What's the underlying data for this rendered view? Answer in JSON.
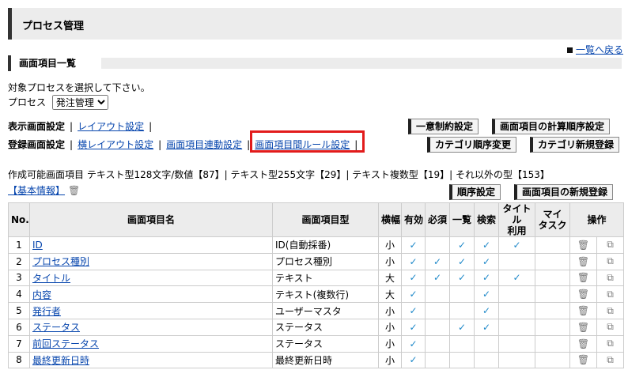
{
  "page_title": "プロセス管理",
  "back_link": "一覧へ戻る",
  "section_title": "画面項目一覧",
  "instruction": "対象プロセスを選択して下さい。",
  "process_label": "プロセス",
  "process_selected": "発注管理",
  "display_settings": {
    "label": "表示画面設定",
    "links": [
      "レイアウト設定"
    ]
  },
  "register_settings": {
    "label": "登録画面設定",
    "links": [
      "横レイアウト設定",
      "画面項目連動設定",
      "画面項目間ルール設定"
    ]
  },
  "buttons": {
    "unique_constraint": "一意制約設定",
    "calc_order": "画面項目の計算順序設定",
    "category_order": "カテゴリ順序変更",
    "category_new": "カテゴリ新規登録",
    "order_settings": "順序設定",
    "item_new": "画面項目の新規登録"
  },
  "type_summary": "作成可能画面項目 テキスト型128文字/数値【87】| テキスト型255文字【29】| テキスト複数型【19】| それ以外の型【153】",
  "basic_info": "【基本情報】",
  "table": {
    "headers": {
      "no": "No.",
      "name": "画面項目名",
      "type": "画面項目型",
      "width": "横幅",
      "valid": "有効",
      "required": "必須",
      "list": "一覧",
      "search": "検索",
      "title_use": "タイトル利用",
      "my_task": "マイタスク",
      "ops": "操作"
    },
    "rows": [
      {
        "no": "1",
        "name": "ID",
        "type": "ID(自動採番)",
        "width": "小",
        "valid": true,
        "required": false,
        "list": true,
        "search": true,
        "title_use": true
      },
      {
        "no": "2",
        "name": "プロセス種別",
        "type": "プロセス種別",
        "width": "小",
        "valid": true,
        "required": true,
        "list": true,
        "search": true,
        "title_use": false
      },
      {
        "no": "3",
        "name": "タイトル",
        "type": "テキスト",
        "width": "大",
        "valid": true,
        "required": true,
        "list": true,
        "search": true,
        "title_use": true
      },
      {
        "no": "4",
        "name": "内容",
        "type": "テキスト(複数行)",
        "width": "大",
        "valid": true,
        "required": false,
        "list": false,
        "search": true,
        "title_use": false
      },
      {
        "no": "5",
        "name": "発行者",
        "type": "ユーザーマスタ",
        "width": "小",
        "valid": true,
        "required": false,
        "list": false,
        "search": true,
        "title_use": false
      },
      {
        "no": "6",
        "name": "ステータス",
        "type": "ステータス",
        "width": "小",
        "valid": true,
        "required": false,
        "list": true,
        "search": true,
        "title_use": false
      },
      {
        "no": "7",
        "name": "前回ステータス",
        "type": "ステータス",
        "width": "小",
        "valid": true,
        "required": false,
        "list": false,
        "search": false,
        "title_use": false
      },
      {
        "no": "8",
        "name": "最終更新日時",
        "type": "最終更新日時",
        "width": "小",
        "valid": true,
        "required": false,
        "list": false,
        "search": false,
        "title_use": false
      }
    ]
  }
}
